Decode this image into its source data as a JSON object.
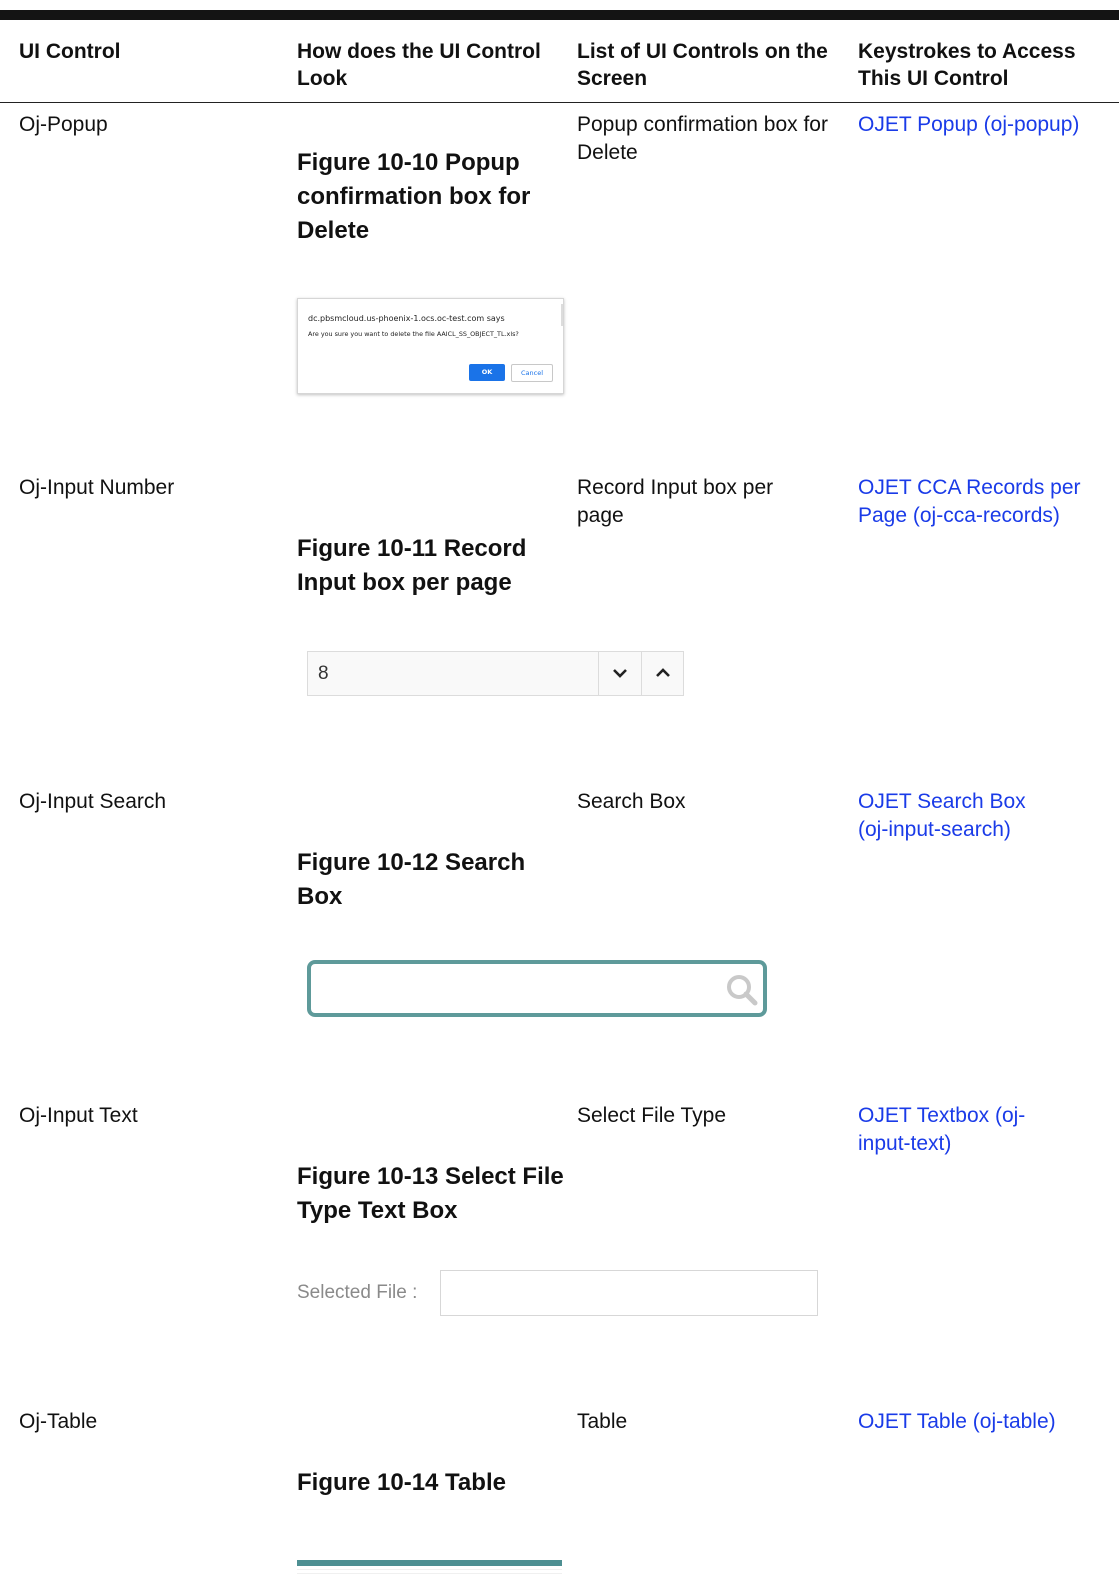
{
  "columns": [
    "UI Control",
    "How does the UI Control Look",
    "List of UI Controls on the Screen",
    "Keystrokes to Access This UI Control"
  ],
  "rows": [
    {
      "control": "Oj-Popup",
      "figure": "Figure 10-10    Popup confirmation box for Delete",
      "list": "Popup confirmation box for Delete",
      "link": "OJET Popup (oj-popup)"
    },
    {
      "control": "Oj-Input Number",
      "figure": "Figure 10-11    Record Input box per page",
      "list": "Record Input box per page",
      "link": "OJET CCA Records per Page (oj-cca-records)"
    },
    {
      "control": "Oj-Input Search",
      "figure": "Figure 10-12    Search Box",
      "list": "Search Box",
      "link": "OJET Search Box (oj-input-search)"
    },
    {
      "control": "Oj-Input Text",
      "figure": "Figure 10-13    Select File Type Text Box",
      "list": "Select File Type",
      "link": "OJET Textbox (oj-input-text)"
    },
    {
      "control": "Oj-Table",
      "figure": "Figure 10-14    Table",
      "list": "Table",
      "link": "OJET Table (oj-table)"
    }
  ],
  "popup": {
    "origin": "dc.pbsmcloud.us-phoenix-1.ocs.oc-test.com says",
    "message": "Are you sure you want to delete the file AAICL_SS_OBJECT_TL.xls?",
    "ok_label": "OK",
    "cancel_label": "Cancel"
  },
  "number_input": {
    "value": "8"
  },
  "text_input": {
    "label": "Selected File :"
  },
  "icons": {
    "chevron_down": "chevron-down-icon",
    "chevron_up": "chevron-up-icon",
    "search": "search-icon"
  },
  "colors": {
    "link": "#1a3be8",
    "search_border": "#5e9a9a",
    "ok_button": "#1a73e8",
    "table_header": "#4d8f92"
  }
}
